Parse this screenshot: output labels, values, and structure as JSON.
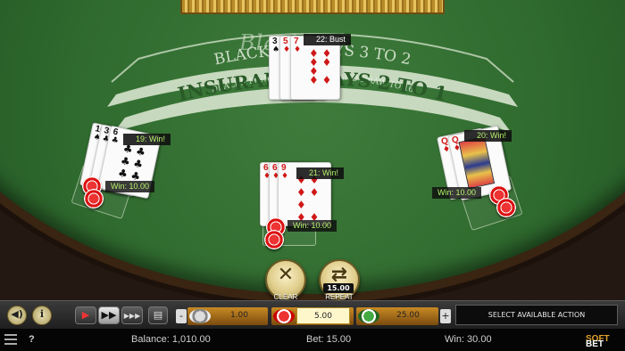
{
  "table": {
    "logo": "Blackjack",
    "line1": "BLACKJACK PAYS 3 TO 2",
    "line2": "DEALER MUST STAND ON 17 AND DRAW TO 16",
    "line3": "INSURANCE PAYS 2 TO 1"
  },
  "dealer": {
    "score": "22: Bust",
    "cards": [
      "3",
      "5",
      "7"
    ]
  },
  "hands": [
    {
      "score": "19: Win!",
      "win": "Win: 10.00",
      "cards": [
        "10",
        "3",
        "6"
      ]
    },
    {
      "score": "21: Win!",
      "win": "Win: 10.00",
      "cards": [
        "6",
        "6",
        "9"
      ]
    },
    {
      "score": "20: Win!",
      "win": "Win: 10.00",
      "cards": [
        "Q",
        "Q"
      ]
    }
  ],
  "actions": {
    "clear_label": "CLEAR",
    "repeat_label": "REPEAT",
    "repeat_amount": "15.00",
    "clear_icon": "x-icon",
    "repeat_icon": "repeat-icon"
  },
  "controls": {
    "sound_icon": "speaker-icon",
    "info_icon": "info-icon",
    "speed_icons": [
      "play-icon",
      "fast-forward-icon",
      "faster-icon"
    ],
    "chips": [
      "1.00",
      "5.00",
      "25.00"
    ],
    "selected_chip": "5.00",
    "minus": "-",
    "plus": "+",
    "action_text": "SELECT AVAILABLE ACTION"
  },
  "status": {
    "help": "?",
    "balance": "Balance: 1,010.00",
    "bet": "Bet: 15.00",
    "win": "Win: 30.00",
    "brand_a": "BET",
    "brand_b": "SOFT"
  },
  "colors": {
    "felt": "#2f6a2e",
    "win_text": "#b5f06a",
    "chip_red": "#d11111",
    "gold": "#dfcd8b"
  }
}
